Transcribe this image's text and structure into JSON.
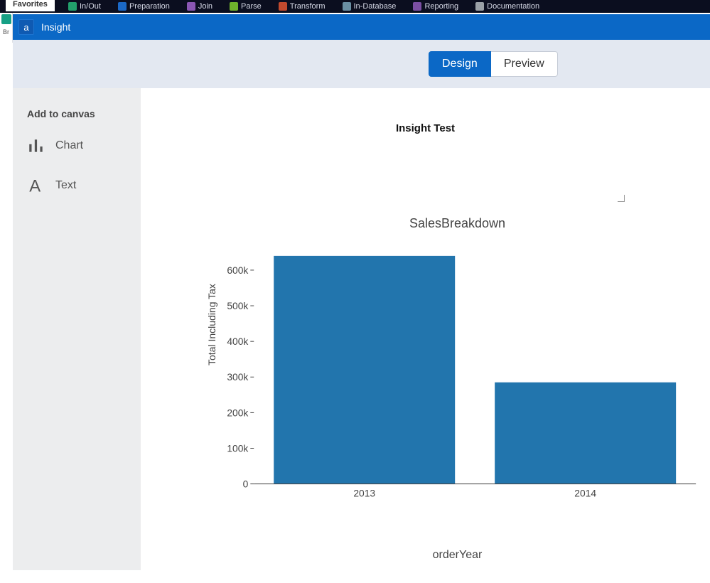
{
  "ribbon": {
    "favorites": "Favorites",
    "items": [
      "In/Out",
      "Preparation",
      "Join",
      "Parse",
      "Transform",
      "In-Database",
      "Reporting",
      "Documentation"
    ]
  },
  "left_sliver": {
    "label": "Br"
  },
  "header": {
    "badge": "a",
    "title": "Insight"
  },
  "view_toggle": {
    "design": "Design",
    "preview": "Preview"
  },
  "sidebar": {
    "heading": "Add to canvas",
    "items": [
      {
        "label": "Chart"
      },
      {
        "label": "Text"
      }
    ]
  },
  "canvas": {
    "title": "Insight Test"
  },
  "chart_data": {
    "type": "bar",
    "title": "SalesBreakdown",
    "xlabel": "orderYear",
    "ylabel": "Total Including Tax",
    "categories": [
      "2013",
      "2014"
    ],
    "values": [
      640000,
      285000
    ],
    "ylim": [
      0,
      650000
    ],
    "yticks": [
      0,
      100000,
      200000,
      300000,
      400000,
      500000,
      600000
    ],
    "ytick_labels": [
      "0",
      "100k",
      "200k",
      "300k",
      "400k",
      "500k",
      "600k"
    ]
  }
}
